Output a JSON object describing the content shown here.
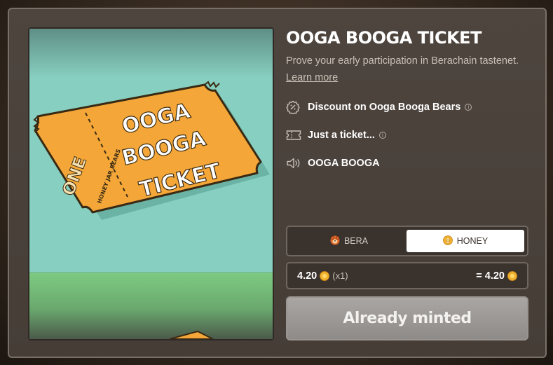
{
  "nft": {
    "title": "OOGA BOOGA TICKET",
    "subtitle": "Prove your early participation in Berachain tastenet.",
    "learn_more": "Learn more",
    "image_alt": "Ooga Booga Ticket artwork"
  },
  "features": [
    {
      "icon": "discount-icon",
      "label": "Discount on Ooga Booga Bears",
      "has_info": true
    },
    {
      "icon": "ticket-icon",
      "label": "Just a ticket...",
      "has_info": true
    },
    {
      "icon": "speaker-icon",
      "label": "OOGA BOOGA",
      "has_info": false
    }
  ],
  "currency_toggle": {
    "options": [
      {
        "label": "BERA",
        "icon": "bera-token-icon",
        "selected": false
      },
      {
        "label": "HONEY",
        "icon": "honey-token-icon",
        "selected": true
      }
    ]
  },
  "price": {
    "unit_price": "4.20",
    "quantity": "(x1)",
    "total": "= 4.20"
  },
  "mint_button": {
    "label": "Already minted",
    "disabled": true
  },
  "colors": {
    "modal_bg": "#4a413b",
    "honey_orange": "#f2a33a",
    "art_teal": "#87cfc0",
    "art_green": "#7dcc84",
    "button_disabled": "#9a9694"
  }
}
